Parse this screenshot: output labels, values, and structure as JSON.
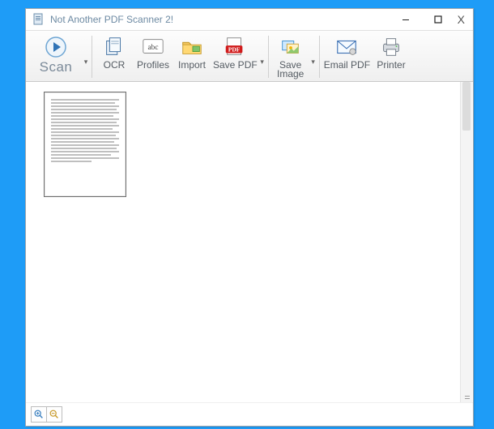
{
  "window": {
    "title": "Not Another PDF Scanner 2!"
  },
  "titlebar_controls": {
    "minimize_glyph": "—",
    "close_glyph": "X"
  },
  "toolbar": {
    "scan": {
      "label": "Scan"
    },
    "ocr": {
      "label": "OCR"
    },
    "profiles": {
      "label": "Profiles"
    },
    "import": {
      "label": "Import"
    },
    "save_pdf": {
      "label": "Save PDF"
    },
    "pdf_red": {
      "label": "PDF"
    },
    "save_image": {
      "label_top": "Save",
      "label_bottom": "Image"
    },
    "email_pdf": {
      "label": "Email PDF"
    },
    "printer": {
      "label": "Printer"
    },
    "dropdown_glyph": "▾"
  },
  "thumbnails": [
    {
      "page": 1
    }
  ],
  "zoom": {
    "in_color": "#3a7fbf",
    "out_color": "#c89a2a"
  }
}
